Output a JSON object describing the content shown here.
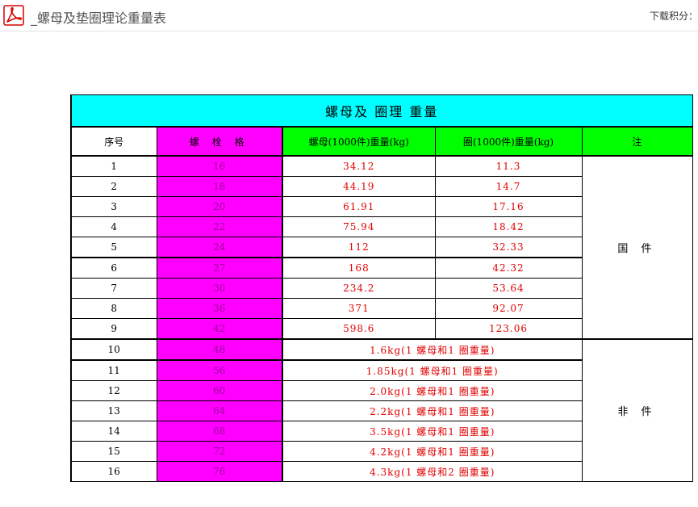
{
  "header": {
    "doc_title": "_螺母及垫圈理论重量表",
    "download_label": "下载积分：",
    "pdf_icon": "pdf-icon"
  },
  "sheet": {
    "title": "螺母及 圈理 重量",
    "columns": [
      "序号",
      "螺 栓  格",
      "螺母(1000件)重量(kg)",
      "圈(1000件)重量(kg)",
      "注"
    ],
    "rows_a": [
      {
        "no": "1",
        "spec": "16",
        "nut": "34.12",
        "washer": "11.3"
      },
      {
        "no": "2",
        "spec": "18",
        "nut": "44.19",
        "washer": "14.7"
      },
      {
        "no": "3",
        "spec": "20",
        "nut": "61.91",
        "washer": "17.16"
      },
      {
        "no": "4",
        "spec": "22",
        "nut": "75.94",
        "washer": "18.42"
      },
      {
        "no": "5",
        "spec": "24",
        "nut": "112",
        "washer": "32.33"
      },
      {
        "no": "6",
        "spec": "27",
        "nut": "168",
        "washer": "42.32"
      },
      {
        "no": "7",
        "spec": "30",
        "nut": "234.2",
        "washer": "53.64"
      },
      {
        "no": "8",
        "spec": "36",
        "nut": "371",
        "washer": "92.07"
      },
      {
        "no": "9",
        "spec": "42",
        "nut": "598.6",
        "washer": "123.06"
      }
    ],
    "note_a": "国 件",
    "rows_b": [
      {
        "no": "10",
        "spec": "48",
        "combined": "1.6kg(1  螺母和1   圈重量)"
      },
      {
        "no": "11",
        "spec": "56",
        "combined": "1.85kg(1  螺母和1   圈重量)"
      },
      {
        "no": "12",
        "spec": "60",
        "combined": "2.0kg(1  螺母和1   圈重量)"
      },
      {
        "no": "13",
        "spec": "64",
        "combined": "2.2kg(1  螺母和1   圈重量)"
      },
      {
        "no": "14",
        "spec": "68",
        "combined": "3.5kg(1  螺母和1   圈重量)"
      },
      {
        "no": "15",
        "spec": "72",
        "combined": "4.2kg(1  螺母和1   圈重量)"
      },
      {
        "no": "16",
        "spec": "76",
        "combined": "4.3kg(1  螺母和2   圈重量)"
      }
    ],
    "note_b": "非 件"
  },
  "colors": {
    "title_bg": "#00ffff",
    "spec_bg": "#ff00ff",
    "header_green": "#00ff00",
    "value_red": "#e10000"
  }
}
